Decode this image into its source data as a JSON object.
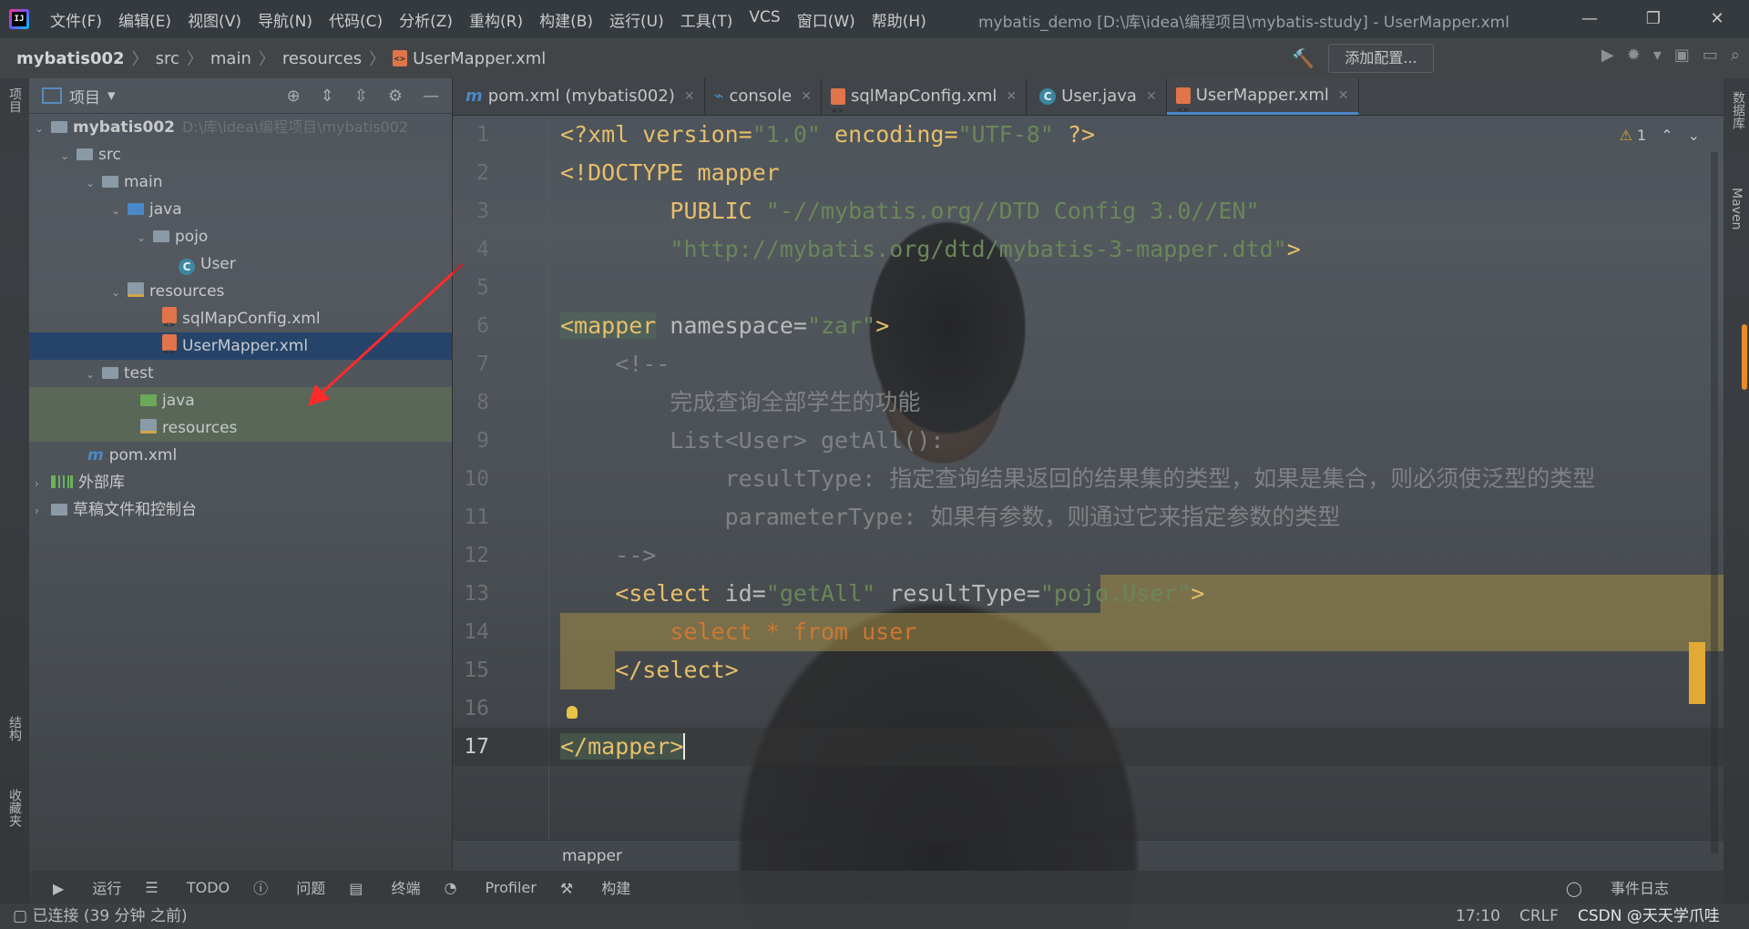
{
  "menu": [
    "文件(F)",
    "编辑(E)",
    "视图(V)",
    "导航(N)",
    "代码(C)",
    "分析(Z)",
    "重构(R)",
    "构建(B)",
    "运行(U)",
    "工具(T)",
    "VCS",
    "窗口(W)",
    "帮助(H)"
  ],
  "window_title": "mybatis_demo [D:\\库\\idea\\编程项目\\mybatis-study] - UserMapper.xml",
  "breadcrumb": [
    "mybatis002",
    "src",
    "main",
    "resources",
    "UserMapper.xml"
  ],
  "add_config": "添加配置...",
  "left_strip": {
    "project": "项目",
    "structure": "结构",
    "favorites": "收藏夹"
  },
  "right_strip": {
    "database": "数据库",
    "maven": "Maven"
  },
  "project_panel": {
    "title": "项目"
  },
  "tree": {
    "root": "mybatis002",
    "root_path": "D:\\库\\idea\\编程项目\\mybatis002",
    "src": "src",
    "main": "main",
    "java": "java",
    "pojo": "pojo",
    "user": "User",
    "resources": "resources",
    "sqlmap": "sqlMapConfig.xml",
    "usermapper": "UserMapper.xml",
    "test": "test",
    "test_java": "java",
    "test_resources": "resources",
    "pom": "pom.xml",
    "ext_libs": "外部库",
    "scratch": "草稿文件和控制台"
  },
  "tabs": [
    {
      "label": "pom.xml (mybatis002)",
      "icon": "maven-icon"
    },
    {
      "label": "console",
      "icon": "console-icon"
    },
    {
      "label": "sqlMapConfig.xml",
      "icon": "xml-icon"
    },
    {
      "label": "User.java",
      "icon": "class-icon"
    },
    {
      "label": "UserMapper.xml",
      "icon": "xml-icon",
      "active": true
    }
  ],
  "editor": {
    "warning_count": "1",
    "line_numbers": [
      "1",
      "2",
      "3",
      "4",
      "5",
      "6",
      "7",
      "8",
      "9",
      "10",
      "11",
      "12",
      "13",
      "14",
      "15",
      "16",
      "17"
    ],
    "code": {
      "l1a": "<?xml version=",
      "l1b": "\"1.0\"",
      "l1c": " encoding=",
      "l1d": "\"UTF-8\"",
      "l1e": " ?>",
      "l2": "<!DOCTYPE mapper",
      "l3a": "        PUBLIC ",
      "l3b": "\"-//mybatis.org//DTD Config 3.0//EN\"",
      "l4a": "        ",
      "l4b": "\"http://mybatis.org/dtd/mybatis-3-mapper.dtd\"",
      "l4c": ">",
      "l6a": "<mapper",
      " l6b": "",
      "l6c": " namespace=",
      "l6d": "\"zar\"",
      "l6e": ">",
      "l7": "    <!--",
      "l8": "        完成查询全部学生的功能",
      "l9": "        List<User> getAll():",
      "l10a": "            resultType: ",
      "l10b": "指定查询结果返回的结果集的类型，如果是集合，则必须使泛型的类型",
      "l11a": "            parameterType: ",
      "l11b": "如果有参数，则通过它来指定参数的类型",
      "l12": "    -->",
      "l13a": "    <select",
      " l13b": "",
      "l13c": " id=",
      "l13d": "\"getAll\"",
      "l13e": " resultType=",
      "l13f": "\"pojo.User\"",
      "l13g": ">",
      "l14": "        select * from user",
      "l15": "    </select>",
      "l17": "</mapper>"
    }
  },
  "editor_breadcrumb": "mapper",
  "bottom_tools": [
    "运行",
    "TODO",
    "问题",
    "终端",
    "Profiler",
    "构建"
  ],
  "event_log": "事件日志",
  "status": {
    "left": "已连接 (39 分钟 之前)",
    "position": "17:10",
    "line_ending": "CRLF",
    "watermark": "CSDN @天天学爪哇"
  }
}
